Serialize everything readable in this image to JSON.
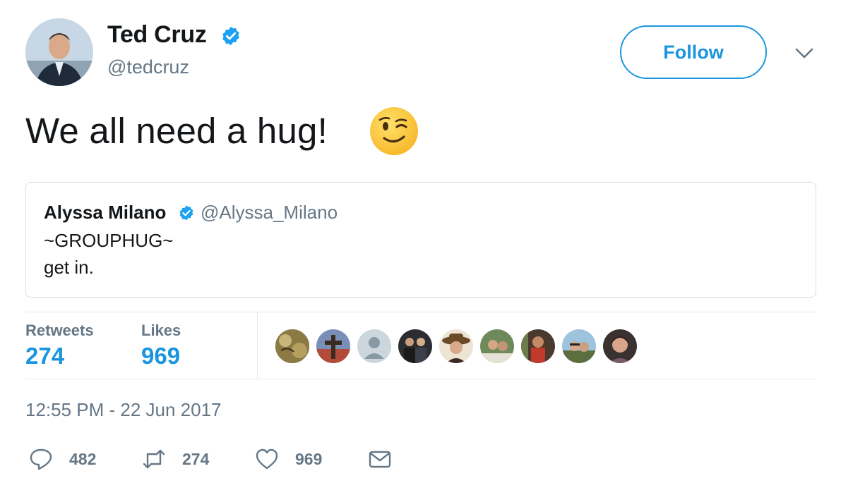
{
  "author": {
    "name": "Ted Cruz",
    "handle": "@tedcruz",
    "follow_label": "Follow"
  },
  "tweet": {
    "text": "We all need a hug!",
    "emoji": "winking-face"
  },
  "quoted_tweet": {
    "name": "Alyssa Milano",
    "handle": "@Alyssa_Milano",
    "lines": [
      "~GROUPHUG~",
      "get in."
    ]
  },
  "stats": {
    "retweets_label": "Retweets",
    "retweets_value": "274",
    "likes_label": "Likes",
    "likes_value": "969",
    "liker_count": 9
  },
  "timestamp": "12:55 PM - 22 Jun 2017",
  "actions": {
    "reply_count": "482",
    "retweet_count": "274",
    "like_count": "969"
  },
  "colors": {
    "accent": "#1b95e0",
    "secondary_text": "#657786",
    "border": "#e1e8ed"
  }
}
